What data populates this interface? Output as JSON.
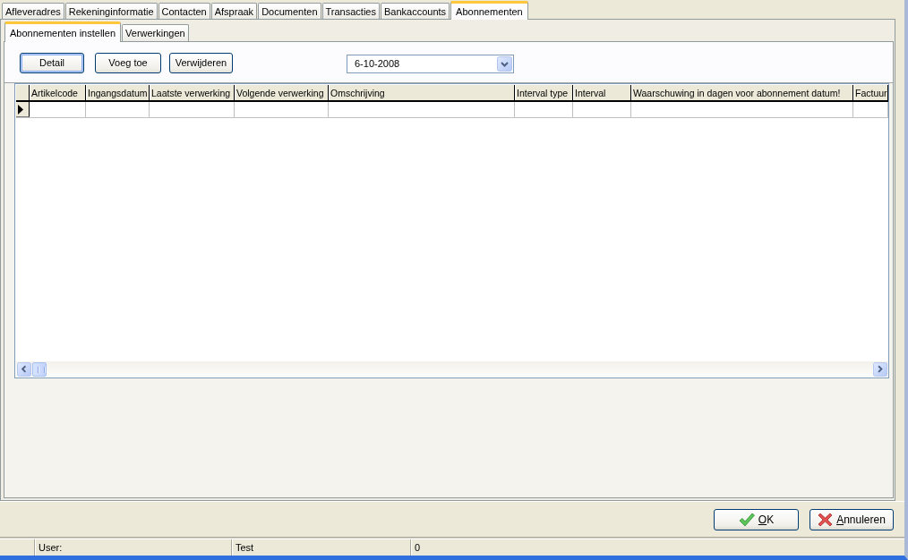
{
  "tabs": [
    {
      "label": "Afleveradres",
      "selected": false
    },
    {
      "label": "Rekeninginformatie",
      "selected": false
    },
    {
      "label": "Contacten",
      "selected": false
    },
    {
      "label": "Afspraak",
      "selected": false
    },
    {
      "label": "Documenten",
      "selected": false
    },
    {
      "label": "Transacties",
      "selected": false
    },
    {
      "label": "Bankaccounts",
      "selected": false
    },
    {
      "label": "Abonnementen",
      "selected": true
    }
  ],
  "subtabs": [
    {
      "label": "Abonnementen instellen",
      "selected": true
    },
    {
      "label": "Verwerkingen",
      "selected": false
    }
  ],
  "toolbar": {
    "buttons": [
      {
        "label": "Detail",
        "focused": true
      },
      {
        "label": "Voeg toe",
        "focused": false
      },
      {
        "label": "Verwijderen",
        "focused": false
      }
    ],
    "date_field": {
      "value": "6-10-2008"
    }
  },
  "grid": {
    "columns": [
      "Artikelcode",
      "Ingangsdatum",
      "Laatste verwerking",
      "Volgende verwerking",
      "Omschrijving",
      "Interval type",
      "Interval",
      "Waarschuwing in dagen voor abonnement datum!",
      "Factuur"
    ],
    "rows": [
      {
        "current": true
      }
    ]
  },
  "dialog_buttons": [
    {
      "label": "OK",
      "kind": "confirm",
      "access_key_underlined": true
    },
    {
      "label": "Annuleren",
      "kind": "cancel",
      "access_key_underlined": true
    }
  ],
  "status_bar": {
    "panels": [
      "User:",
      "Test",
      "0"
    ]
  }
}
